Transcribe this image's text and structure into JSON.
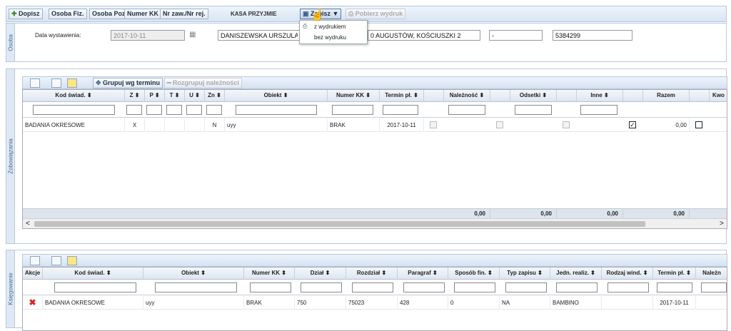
{
  "toolbar": {
    "buttons": [
      "Dopisz",
      "Osoba Fiz.",
      "Osoba Poz.",
      "Numer KK",
      "Nr zaw./Nr rej."
    ],
    "kasa_label": "KASA PRZYJMIE",
    "zapisz_label": "Zapisz ▼",
    "pobierz_label": "Pobierz wydruk"
  },
  "dropdown": {
    "items": [
      "z wydrukiem",
      "bez wydruku"
    ]
  },
  "osoba": {
    "tab_label": "Osoba",
    "date_label": "Data wystawienia:",
    "date_value": "2017-10-11",
    "name_value": "DANISZEWSKA URSZULA",
    "address_value": "0 AUGUSTÓW, KOŚCIUSZKI 2",
    "dash_value": "-",
    "number_value": "5384299"
  },
  "zobowiazania": {
    "tab_label": "Zobowiązania",
    "group_btn": "Grupuj wg terminu",
    "ungroup_btn": "Rozgrupuj należności",
    "columns": [
      "Kod świad. ⬍",
      "Z ⬍",
      "P ⬍",
      "T ⬍",
      "U ⬍",
      "Zn ⬍",
      "Obiekt ⬍",
      "Numer KK ⬍",
      "Termin pł. ⬍",
      "",
      "Należność ⬍",
      "",
      "Odsetki ⬍",
      "",
      "Inne ⬍",
      "",
      "Razem",
      "",
      "Kwo"
    ],
    "row": {
      "kod": "BADANIA OKRESOWE",
      "z": "X",
      "zn": "N",
      "obiekt": "uyy",
      "numer": "BRAK",
      "termin": "2017-10-11",
      "razem": "0,00"
    },
    "sums": [
      "0,00",
      "0,00",
      "0,00",
      "0,00"
    ],
    "scroll_left": "<",
    "scroll_right": ">"
  },
  "ksiegowanie": {
    "tab_label": "Księgowanie",
    "columns": [
      "Akcje",
      "Kod świad. ⬍",
      "Obiekt ⬍",
      "Numer KK ⬍",
      "Dział ⬍",
      "Rozdział ⬍",
      "Paragraf ⬍",
      "Sposób fin. ⬍",
      "Typ zapisu ⬍",
      "Jedn. realiz. ⬍",
      "Rodzaj wind. ⬍",
      "Termin pł. ⬍",
      "Należn"
    ],
    "row": {
      "kod": "BADANIA OKRESOWE",
      "obiekt": "uyy",
      "numer": "BRAK",
      "dzial": "750",
      "rozdzial": "75023",
      "paragraf": "428",
      "sposob": "0",
      "typ": "NA",
      "jedn": "BAMBINO",
      "termin": "2017-10-11"
    }
  },
  "colors": {
    "accent": "#4a6a91",
    "delete": "#d22"
  }
}
